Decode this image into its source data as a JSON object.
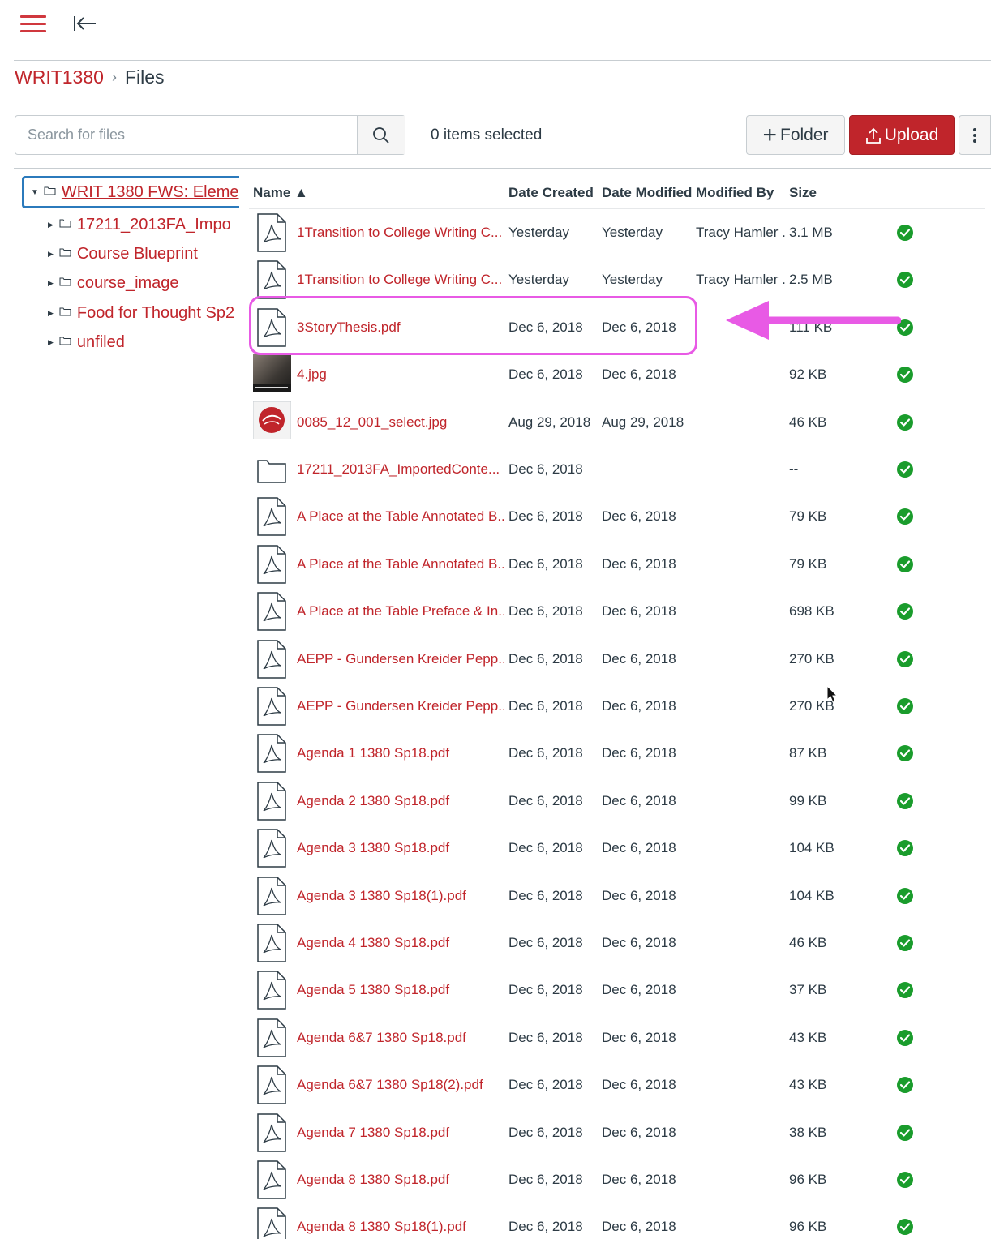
{
  "breadcrumb": {
    "course": "WRIT1380",
    "separator": "›",
    "current": "Files"
  },
  "toolbar": {
    "search_placeholder": "Search for files",
    "selected_text": "0 items selected",
    "folder_label": "Folder",
    "upload_label": "Upload"
  },
  "tree": {
    "root": "WRIT 1380 FWS: Eleme",
    "items": [
      "17211_2013FA_Impo",
      "Course Blueprint",
      "course_image",
      "Food for Thought Sp2",
      "unfiled"
    ]
  },
  "columns": {
    "name": "Name ▲",
    "created": "Date Created",
    "modified": "Date Modified",
    "modified_by": "Modified By",
    "size": "Size"
  },
  "colors": {
    "accent": "#c0252b",
    "highlight": "#e85ae5",
    "status_ok": "#1a9c2c",
    "focus": "#2b7abc"
  },
  "files": [
    {
      "icon": "pdf-icon",
      "name": "1Transition to College Writing C...",
      "created": "Yesterday",
      "modified": "Yesterday",
      "modified_by": "Tracy Hamler ...",
      "size": "3.1 MB"
    },
    {
      "icon": "pdf-icon",
      "name": "1Transition to College Writing C...",
      "created": "Yesterday",
      "modified": "Yesterday",
      "modified_by": "Tracy Hamler ...",
      "size": "2.5 MB"
    },
    {
      "icon": "pdf-icon",
      "name": "3StoryThesis.pdf",
      "created": "Dec 6, 2018",
      "modified": "Dec 6, 2018",
      "modified_by": "",
      "size": "111 KB"
    },
    {
      "icon": "image-thumbnail",
      "name": "4.jpg",
      "created": "Dec 6, 2018",
      "modified": "Dec 6, 2018",
      "modified_by": "",
      "size": "92 KB"
    },
    {
      "icon": "image-thumbnail-logo",
      "name": "0085_12_001_select.jpg",
      "created": "Aug 29, 2018",
      "modified": "Aug 29, 2018",
      "modified_by": "",
      "size": "46 KB"
    },
    {
      "icon": "folder-icon",
      "name": "17211_2013FA_ImportedConte...",
      "created": "Dec 6, 2018",
      "modified": "",
      "modified_by": "",
      "size": "--"
    },
    {
      "icon": "pdf-icon",
      "name": "A Place at the Table Annotated B...",
      "created": "Dec 6, 2018",
      "modified": "Dec 6, 2018",
      "modified_by": "",
      "size": "79 KB"
    },
    {
      "icon": "pdf-icon",
      "name": "A Place at the Table Annotated B...",
      "created": "Dec 6, 2018",
      "modified": "Dec 6, 2018",
      "modified_by": "",
      "size": "79 KB"
    },
    {
      "icon": "pdf-icon",
      "name": "A Place at the Table Preface & In...",
      "created": "Dec 6, 2018",
      "modified": "Dec 6, 2018",
      "modified_by": "",
      "size": "698 KB"
    },
    {
      "icon": "pdf-icon",
      "name": "AEPP - Gundersen Kreider Pepp...",
      "created": "Dec 6, 2018",
      "modified": "Dec 6, 2018",
      "modified_by": "",
      "size": "270 KB"
    },
    {
      "icon": "pdf-icon",
      "name": "AEPP - Gundersen Kreider Pepp...",
      "created": "Dec 6, 2018",
      "modified": "Dec 6, 2018",
      "modified_by": "",
      "size": "270 KB"
    },
    {
      "icon": "pdf-icon",
      "name": "Agenda 1 1380 Sp18.pdf",
      "created": "Dec 6, 2018",
      "modified": "Dec 6, 2018",
      "modified_by": "",
      "size": "87 KB"
    },
    {
      "icon": "pdf-icon",
      "name": "Agenda 2 1380 Sp18.pdf",
      "created": "Dec 6, 2018",
      "modified": "Dec 6, 2018",
      "modified_by": "",
      "size": "99 KB"
    },
    {
      "icon": "pdf-icon",
      "name": "Agenda 3 1380 Sp18.pdf",
      "created": "Dec 6, 2018",
      "modified": "Dec 6, 2018",
      "modified_by": "",
      "size": "104 KB"
    },
    {
      "icon": "pdf-icon",
      "name": "Agenda 3 1380 Sp18(1).pdf",
      "created": "Dec 6, 2018",
      "modified": "Dec 6, 2018",
      "modified_by": "",
      "size": "104 KB"
    },
    {
      "icon": "pdf-icon",
      "name": "Agenda 4 1380 Sp18.pdf",
      "created": "Dec 6, 2018",
      "modified": "Dec 6, 2018",
      "modified_by": "",
      "size": "46 KB"
    },
    {
      "icon": "pdf-icon",
      "name": "Agenda 5 1380 Sp18.pdf",
      "created": "Dec 6, 2018",
      "modified": "Dec 6, 2018",
      "modified_by": "",
      "size": "37 KB"
    },
    {
      "icon": "pdf-icon",
      "name": "Agenda 6&7 1380 Sp18.pdf",
      "created": "Dec 6, 2018",
      "modified": "Dec 6, 2018",
      "modified_by": "",
      "size": "43 KB"
    },
    {
      "icon": "pdf-icon",
      "name": "Agenda 6&7 1380 Sp18(2).pdf",
      "created": "Dec 6, 2018",
      "modified": "Dec 6, 2018",
      "modified_by": "",
      "size": "43 KB"
    },
    {
      "icon": "pdf-icon",
      "name": "Agenda 7 1380 Sp18.pdf",
      "created": "Dec 6, 2018",
      "modified": "Dec 6, 2018",
      "modified_by": "",
      "size": "38 KB"
    },
    {
      "icon": "pdf-icon",
      "name": "Agenda 8 1380 Sp18.pdf",
      "created": "Dec 6, 2018",
      "modified": "Dec 6, 2018",
      "modified_by": "",
      "size": "96 KB"
    },
    {
      "icon": "pdf-icon",
      "name": "Agenda 8 1380 Sp18(1).pdf",
      "created": "Dec 6, 2018",
      "modified": "Dec 6, 2018",
      "modified_by": "",
      "size": "96 KB"
    }
  ]
}
